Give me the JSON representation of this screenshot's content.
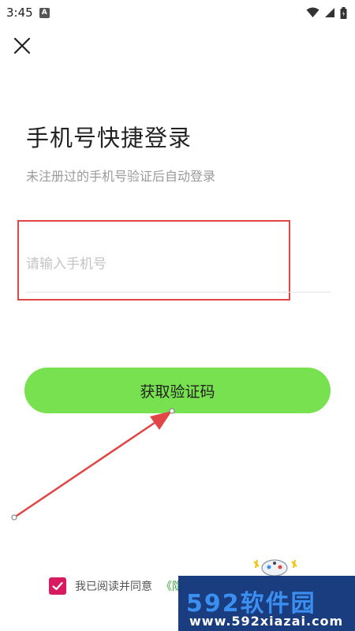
{
  "status_bar": {
    "time": "3:45",
    "app_icon_letter": "A",
    "icons": [
      "wifi-icon",
      "signal-icon",
      "battery-icon"
    ]
  },
  "header": {
    "close_icon": "close-icon"
  },
  "login": {
    "title": "手机号快捷登录",
    "subtitle": "未注册过的手机号验证后自动登录",
    "phone_placeholder": "请输入手机号",
    "phone_value": "",
    "get_code_label": "获取验证码"
  },
  "agreement": {
    "checked": true,
    "text": "我已阅读并同意",
    "link_text": "《隐"
  },
  "watermark": {
    "brand": "592软件园",
    "url": "www.592xiazai.com"
  },
  "colors": {
    "button_green": "#78e14f",
    "highlight_red": "#e24545",
    "checkbox_pink": "#d81b60",
    "link_green": "#3aa13a",
    "watermark_blue": "#1a3d80"
  }
}
